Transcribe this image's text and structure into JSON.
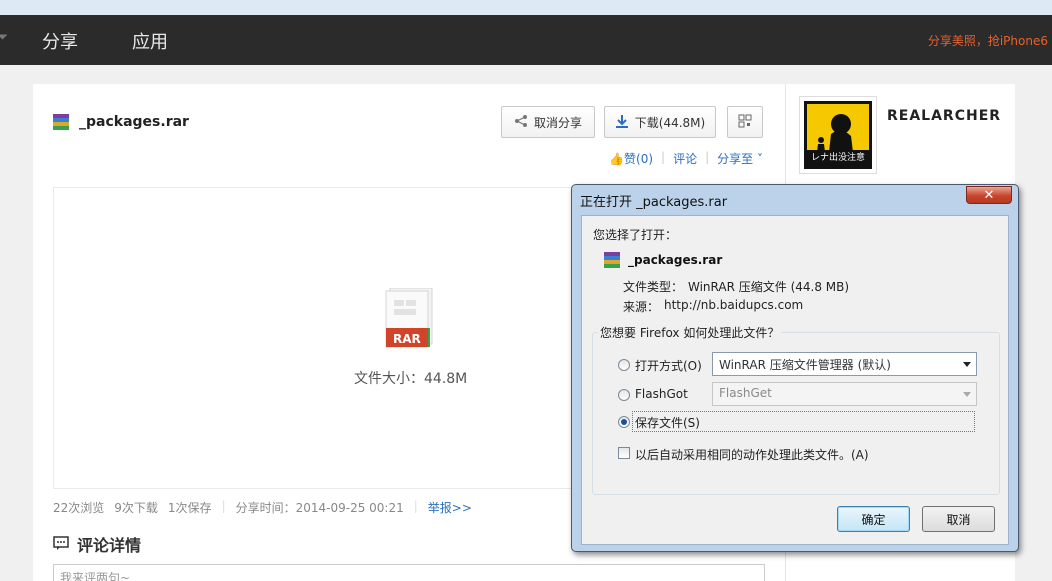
{
  "navbar": {
    "items": [
      "分享",
      "应用"
    ],
    "promo": "分享美照，抢iPhone6"
  },
  "file": {
    "name": "_packages.rar",
    "cancel_share": "取消分享",
    "download": "下载(44.8M)",
    "like": "赞(0)",
    "comment": "评论",
    "share_to": "分享至",
    "preview_badge": "RAR",
    "size_text": "文件大小：44.8M"
  },
  "stats": {
    "views": "22次浏览",
    "downloads": "9次下载",
    "saves": "1次保存",
    "share_time": "分享时间：2014-09-25 00:21",
    "report": "举报>>"
  },
  "comments": {
    "heading": "评论详情",
    "placeholder": "我来评两句~"
  },
  "user": {
    "name": "REALARCHER",
    "avatar_caption": "レナ出没注意"
  },
  "dialog": {
    "title": "正在打开 _packages.rar",
    "close": "✕",
    "chose_label": "您选择了打开：",
    "filename": "_packages.rar",
    "type_label": "文件类型：",
    "type_value": "WinRAR 压缩文件 (44.8 MB)",
    "source_label": "来源：",
    "source_value": "http://nb.baidupcs.com",
    "question": "您想要 Firefox 如何处理此文件？",
    "open_with_label": "打开方式(O)",
    "open_with_value": "WinRAR 压缩文件管理器 (默认)",
    "flashgot_label": "FlashGot",
    "flashgot_value": "FlashGet",
    "save_label": "保存文件(S)",
    "remember_label": "以后自动采用相同的动作处理此类文件。(A)",
    "ok": "确定",
    "cancel": "取消",
    "selected_option": "save"
  },
  "colors": {
    "navbar": "#2b2b2b",
    "promo": "#e8622c",
    "link": "#2a6fbf",
    "rar_badge": "#d0452a"
  }
}
